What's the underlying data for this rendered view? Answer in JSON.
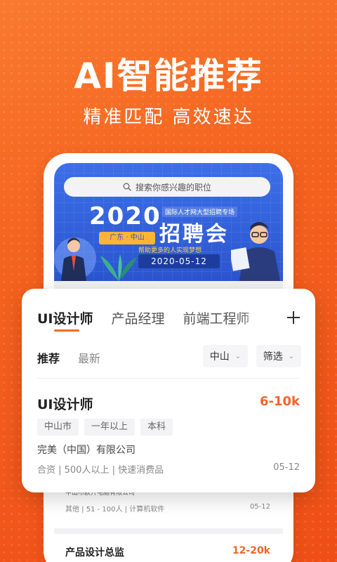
{
  "hero": {
    "title": "AI智能推荐",
    "subtitle": "精准匹配 高效速达"
  },
  "search": {
    "placeholder": "搜索你感兴趣的职位",
    "icon": "search-icon"
  },
  "banner": {
    "year": "2020",
    "location": "广东 · 中山",
    "topline": "国际人才网大型招聘专场",
    "main": "招聘会",
    "tagline": "帮助更多的人实现梦想",
    "date": "2020-05-12"
  },
  "tabs": [
    {
      "label": "UI设计师",
      "active": true
    },
    {
      "label": "产品经理",
      "active": false
    },
    {
      "label": "前端工程师",
      "active": false
    }
  ],
  "add_icon": "plus-icon",
  "sort": {
    "recommended": "推荐",
    "latest": "最新"
  },
  "filters": {
    "city": "中山",
    "filter": "筛选"
  },
  "job": {
    "title": "UI设计师",
    "salary": "6-10k",
    "tags": [
      "中山市",
      "一年以上",
      "本科"
    ],
    "company": "完美（中国）有限公司",
    "meta": "合资 | 500人以上 | 快速消费品",
    "date": "05-12"
  },
  "bg_job": {
    "company": "中山市欧开电脑有限公司",
    "meta": "其他 | 51 - 100人 | 计算机软件",
    "date": "05-12"
  },
  "bg_job2": {
    "title": "产品设计总监",
    "salary": "12-20k"
  },
  "colors": {
    "accent": "#f2662a",
    "banner_blue": "#2a55cf",
    "background": "#f4621f"
  }
}
